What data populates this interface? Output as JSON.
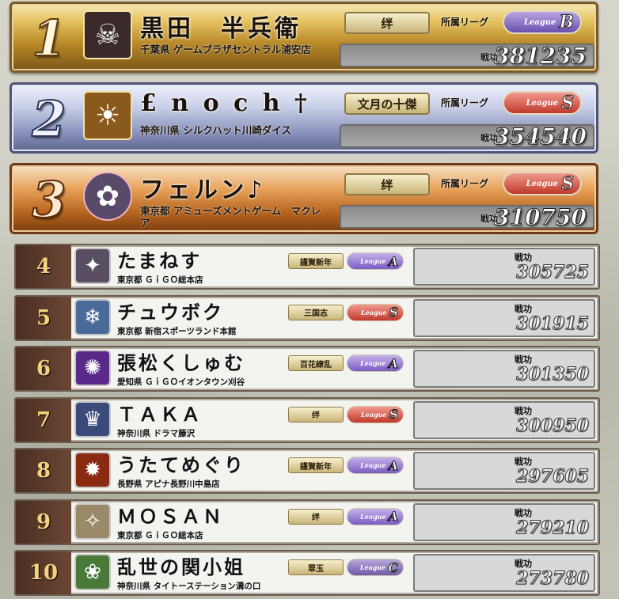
{
  "labels": {
    "league": "所属リーグ",
    "score": "戦功",
    "league_prefix": "League"
  },
  "top": [
    {
      "rank": "1",
      "name": "黒田　半兵衛",
      "store": "千葉県 ゲームプラザセントラル浦安店",
      "title": "绊",
      "league": "B",
      "score": "381235",
      "style": "gold",
      "avatar_icon": "☠",
      "avatar_color": "#3b2a2a",
      "round": false
    },
    {
      "rank": "2",
      "name": "£ n o c h †",
      "store": "神奈川県 シルクハット川崎ダイス",
      "title": "文月の十傑",
      "league": "S",
      "score": "354540",
      "style": "silver",
      "avatar_icon": "☀",
      "avatar_color": "#8a5a1c",
      "round": false
    },
    {
      "rank": "3",
      "name": "フェルン♪",
      "store": "東京都 アミューズメントゲーム　マクレア",
      "title": "绊",
      "league": "S",
      "score": "310750",
      "style": "bronze",
      "avatar_icon": "✿",
      "avatar_color": "#5a4a6a",
      "round": true
    }
  ],
  "rows": [
    {
      "rank": "4",
      "name": "たまねす",
      "store": "東京都 ＧｉＧＯ総本店",
      "title": "謹賀新年",
      "league": "A",
      "score": "305725",
      "avatar_icon": "✦",
      "avatar_color": "#5a4e62"
    },
    {
      "rank": "5",
      "name": "チュウボク",
      "store": "東京都 新宿スポーツランド本館",
      "title": "三国志",
      "league": "S",
      "score": "301915",
      "avatar_icon": "❄",
      "avatar_color": "#4a6a9a"
    },
    {
      "rank": "6",
      "name": "張松くしゅむ",
      "store": "愛知県 ＧｉＧＯイオンタウン刈谷",
      "title": "百花繚乱",
      "league": "A",
      "score": "301350",
      "avatar_icon": "✺",
      "avatar_color": "#5a2a8a"
    },
    {
      "rank": "7",
      "name": "ＴＡＫＡ",
      "store": "神奈川県 ドラマ藤沢",
      "title": "绊",
      "league": "S",
      "score": "300950",
      "avatar_icon": "♛",
      "avatar_color": "#3a4a7a"
    },
    {
      "rank": "8",
      "name": "うたてめぐり",
      "store": "長野県 アピナ長野川中島店",
      "title": "謹賀新年",
      "league": "A",
      "score": "297605",
      "avatar_icon": "✹",
      "avatar_color": "#8a2a10"
    },
    {
      "rank": "9",
      "name": "ＭＯＳＡＮ",
      "store": "東京都 ＧｉＧＯ総本店",
      "title": "绊",
      "league": "A",
      "score": "279210",
      "avatar_icon": "✧",
      "avatar_color": "#9a8a6a"
    },
    {
      "rank": "10",
      "name": "乱世の関小姐",
      "store": "神奈川県 タイトーステーション溝の口",
      "title": "翠玉",
      "league": "C",
      "score": "273780",
      "avatar_icon": "❀",
      "avatar_color": "#4a7a3a"
    }
  ]
}
